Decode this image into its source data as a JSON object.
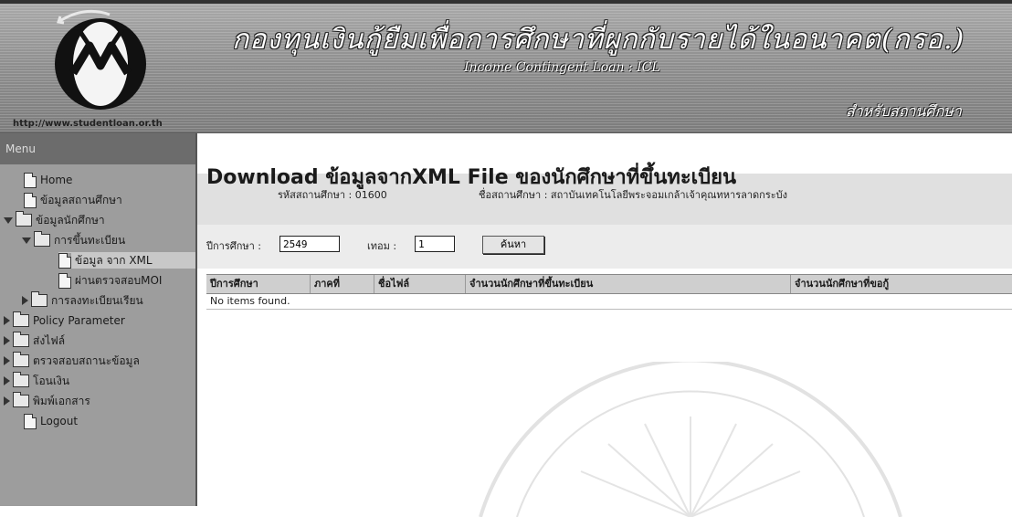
{
  "header": {
    "logo_url": "http://www.studentloan.or.th",
    "title_thai": "กองทุนเงินกู้ยืมเพื่อการศึกษาที่ผูกกับรายได้ในอนาคต(กรอ.)",
    "title_english": "Income Contingent Loan : ICL",
    "subtitle_right": "สำหรับสถานศึกษา"
  },
  "sidebar": {
    "menu_label": "Menu",
    "items": [
      {
        "label": "Home",
        "icon": "document-icon"
      },
      {
        "label": "ข้อมูลสถานศึกษา",
        "icon": "document-icon"
      },
      {
        "label": "ข้อมูลนักศึกษา",
        "icon": "folder-icon",
        "expanded": true
      },
      {
        "label": "การขึ้นทะเบียน",
        "icon": "folder-icon",
        "expanded": true
      },
      {
        "label": "ข้อมูล จาก XML",
        "icon": "document-icon",
        "selected": true
      },
      {
        "label": "ผ่านตรวจสอบMOI",
        "icon": "document-icon"
      },
      {
        "label": "การลงทะเบียนเรียน",
        "icon": "folder-icon",
        "expanded": false
      },
      {
        "label": "Policy Parameter",
        "icon": "folder-icon",
        "expanded": false
      },
      {
        "label": "ส่งไฟล์",
        "icon": "folder-icon",
        "expanded": false
      },
      {
        "label": "ตรวจสอบสถานะข้อมูล",
        "icon": "folder-icon",
        "expanded": false
      },
      {
        "label": "โอนเงิน",
        "icon": "folder-icon",
        "expanded": false
      },
      {
        "label": "พิมพ์เอกสาร",
        "icon": "folder-icon",
        "expanded": false
      },
      {
        "label": "Logout",
        "icon": "document-icon"
      }
    ]
  },
  "main": {
    "title": "Download ข้อมูลจากXML File ของนักศึกษาที่ขึ้นทะเบียน",
    "institution_code_label": "รหัสสถานศึกษา : 01600",
    "institution_name_label": "ชื่อสถานศึกษา : สถาบันเทคโนโลยีพระจอมเกล้าเจ้าคุณทหารลาดกระบัง",
    "academic_year_label": "ปีการศึกษา :",
    "academic_year_value": "2549",
    "term_label": "เทอม :",
    "term_value": "1",
    "search_button": "ค้นหา",
    "table": {
      "headers": [
        "ปีการศึกษา",
        "ภาคที่",
        "ชื่อไฟล์",
        "จำนวนนักศึกษาที่ขึ้นทะเบียน",
        "จำนวนนักศึกษาที่ขอกู้"
      ],
      "empty_message": "No items found."
    }
  },
  "colors": {
    "header_bg": "#8d8d8d",
    "sidebar_bg": "#9d9d9d",
    "table_header_bg": "#cfcfcf"
  }
}
